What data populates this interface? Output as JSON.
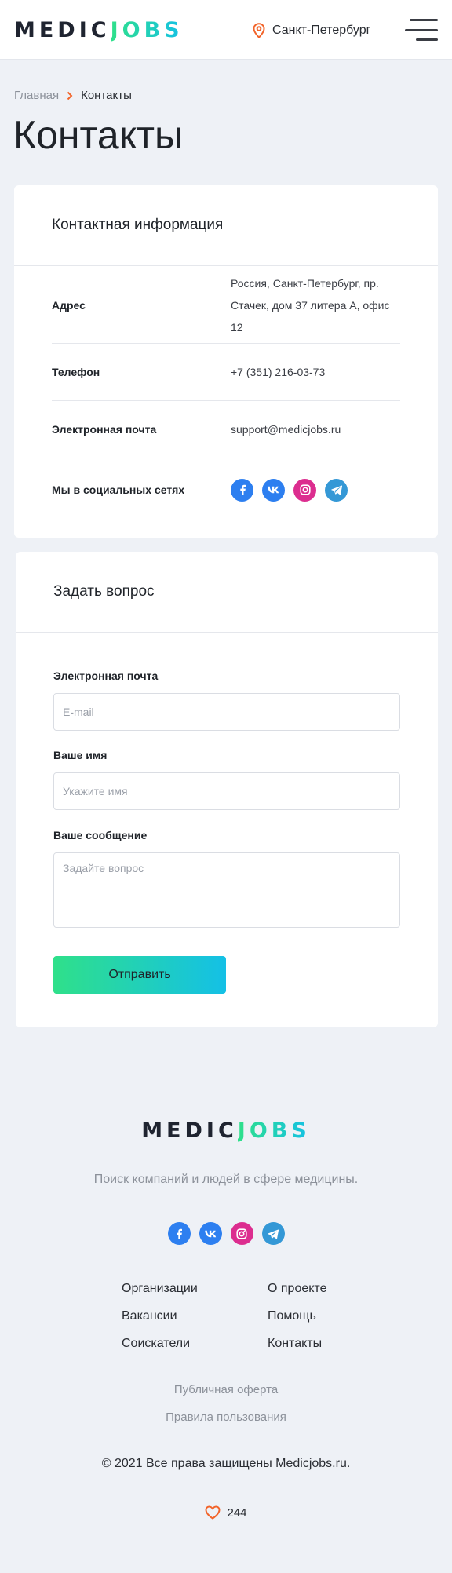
{
  "header": {
    "logo_part1": "MEDIC",
    "logo_part2": "JOBS",
    "city": "Санкт-Петербург"
  },
  "breadcrumb": {
    "home": "Главная",
    "current": "Контакты"
  },
  "page_title": "Контакты",
  "contacts": {
    "title": "Контактная информация",
    "address_label": "Адрес",
    "address_line1": "Россия, Санкт-Петербург, пр.",
    "address_line2": "Стачек, дом 37 литера А, офис 12",
    "phone_label": "Телефон",
    "phone_value": "+7 (351) 216-03-73",
    "email_label": "Электронная почта",
    "email_value": "support@medicjobs.ru",
    "social_label": "Мы в социальных сетях"
  },
  "form": {
    "title": "Задать вопрос",
    "email_label": "Электронная почта",
    "email_placeholder": "E-mail",
    "name_label": "Ваше имя",
    "name_placeholder": "Укажите имя",
    "message_label": "Ваше сообщение",
    "message_placeholder": "Задайте вопрос",
    "submit_label": "Отправить"
  },
  "footer": {
    "logo_part1": "MEDIC",
    "logo_part2": "JOBS",
    "tagline": "Поиск компаний и людей в сфере медицины.",
    "nav_col1": [
      "Организации",
      "Вакансии",
      "Соискатели"
    ],
    "nav_col2": [
      "О проекте",
      "Помощь",
      "Контакты"
    ],
    "offer_link": "Публичная оферта",
    "terms_link": "Правила пользования",
    "copyright": "© 2021 Все права защищены Medicjobs.ru.",
    "likes_count": "244"
  },
  "colors": {
    "accent_green": "#2fe08a",
    "accent_blue": "#14c0e6",
    "location_orange": "#f2642a",
    "facebook": "#2d7ff0",
    "vk": "#2d7ff0",
    "instagram": "#dc2d8f",
    "telegram": "#3498d6"
  }
}
